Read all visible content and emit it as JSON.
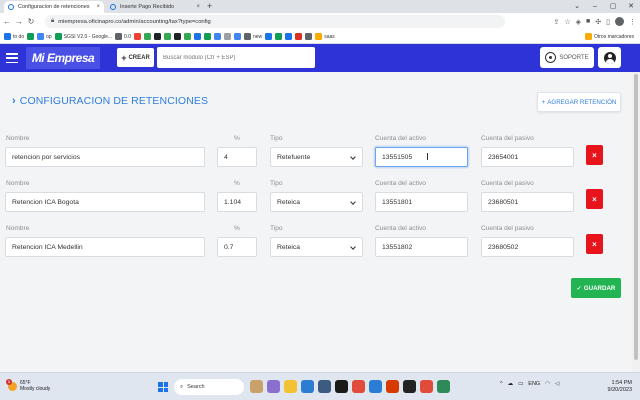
{
  "browser": {
    "tabs": [
      {
        "title": "Configuracion de retenciones",
        "active": true
      },
      {
        "title": "Inserte Pago Recibido",
        "active": false
      }
    ],
    "url": "miempresa.oficinapro.co/admin/accounting/tax?type=config",
    "bookmarks": [
      "to do",
      "",
      "op",
      "SGSI V2.0 - Google...",
      "0.0",
      "",
      "",
      "",
      "",
      "",
      "",
      "",
      "",
      "",
      "",
      "",
      "new",
      "",
      "",
      "",
      "",
      "",
      "saas"
    ],
    "other_bookmarks": "Otros marcadores"
  },
  "header": {
    "logo": "Mi Empresa",
    "crear_label": "CREAR",
    "search_placeholder": "Buscar módulo (Ctr + ESP)",
    "soporte_label": "SOPORTE"
  },
  "page": {
    "title": "CONFIGURACION DE RETENCIONES",
    "add_button": "AGREGAR RETENCIÓN",
    "save_button": "GUARDAR",
    "labels": {
      "nombre": "Nombre",
      "pct": "%",
      "tipo": "Tipo",
      "activo": "Cuenta del activo",
      "pasivo": "Cuenta del pasivo"
    },
    "rows": [
      {
        "nombre": "retencion por servicios",
        "pct": "4",
        "tipo": "Retefuente",
        "activo": "13551505",
        "pasivo": "23654001"
      },
      {
        "nombre": "Retencion ICA Bogota",
        "pct": "1.104",
        "tipo": "Reteica",
        "activo": "13551801",
        "pasivo": "23680501"
      },
      {
        "nombre": "Retencion ICA Medellin",
        "pct": "0.7",
        "tipo": "Reteica",
        "activo": "13551802",
        "pasivo": "23680502"
      }
    ]
  },
  "taskbar": {
    "temp": "65°F",
    "weather": "Mostly cloudy",
    "search": "Search",
    "lang": "ENG",
    "time": "1:54 PM",
    "date": "9/20/2023"
  }
}
